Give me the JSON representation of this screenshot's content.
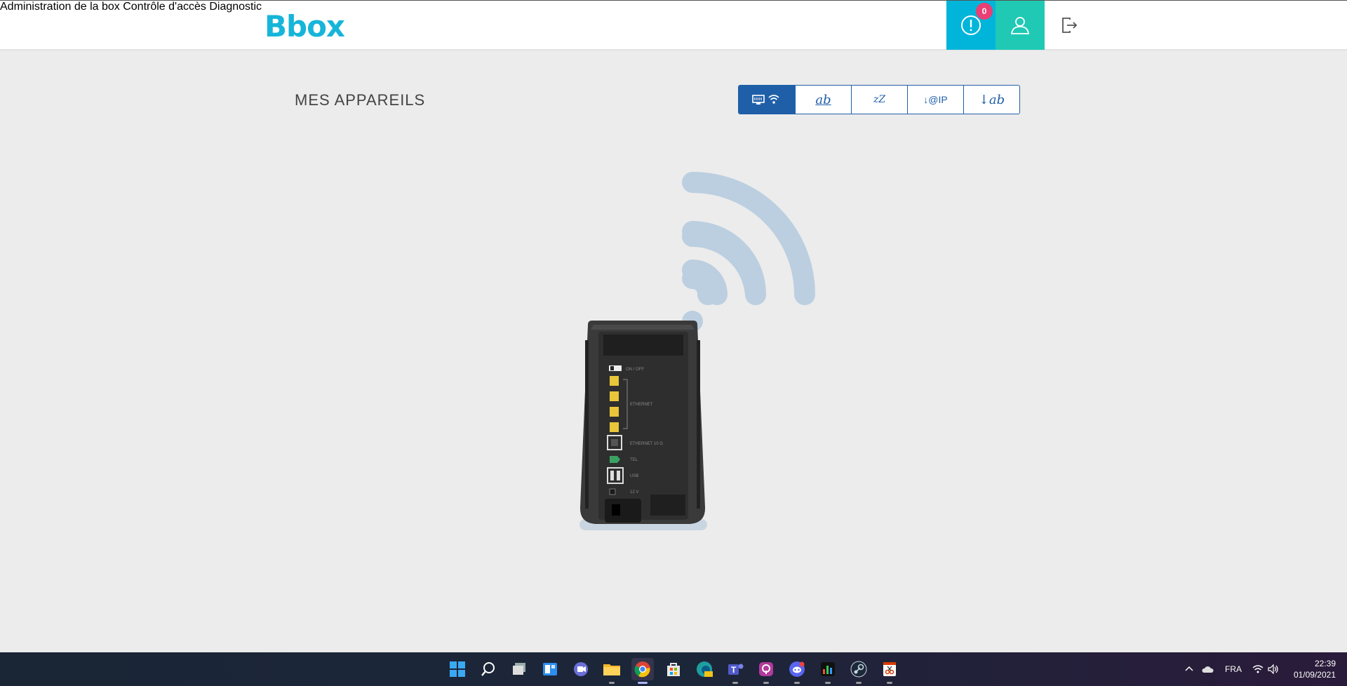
{
  "header": {
    "logo": "Bbox",
    "nav": {
      "admin": "Administration de la box",
      "access": "Contrôle d'accès",
      "diag": "Diagnostic"
    },
    "alert_count": "0"
  },
  "main": {
    "title": "MES APPAREILS",
    "toolbar": {
      "sort_name": "ab",
      "sort_sleep": "zZ",
      "sort_ip": "↓@IP",
      "sort_alpha": "↓ab"
    }
  },
  "router": {
    "labels": {
      "onoff": "ON / OFF",
      "ethernet": "ETHERNET",
      "ethernet10g": "ETHERNET 10 G",
      "tel": "TEL",
      "usb": "USB",
      "power": "12 V"
    }
  },
  "taskbar": {
    "language": "FRA",
    "time": "22:39",
    "date": "01/09/2021"
  },
  "colors": {
    "brand": "#16b5d9",
    "alert": "#00b5d9",
    "user": "#1fc9b4",
    "badge": "#e93f74",
    "toolbar": "#1f5fa8"
  }
}
